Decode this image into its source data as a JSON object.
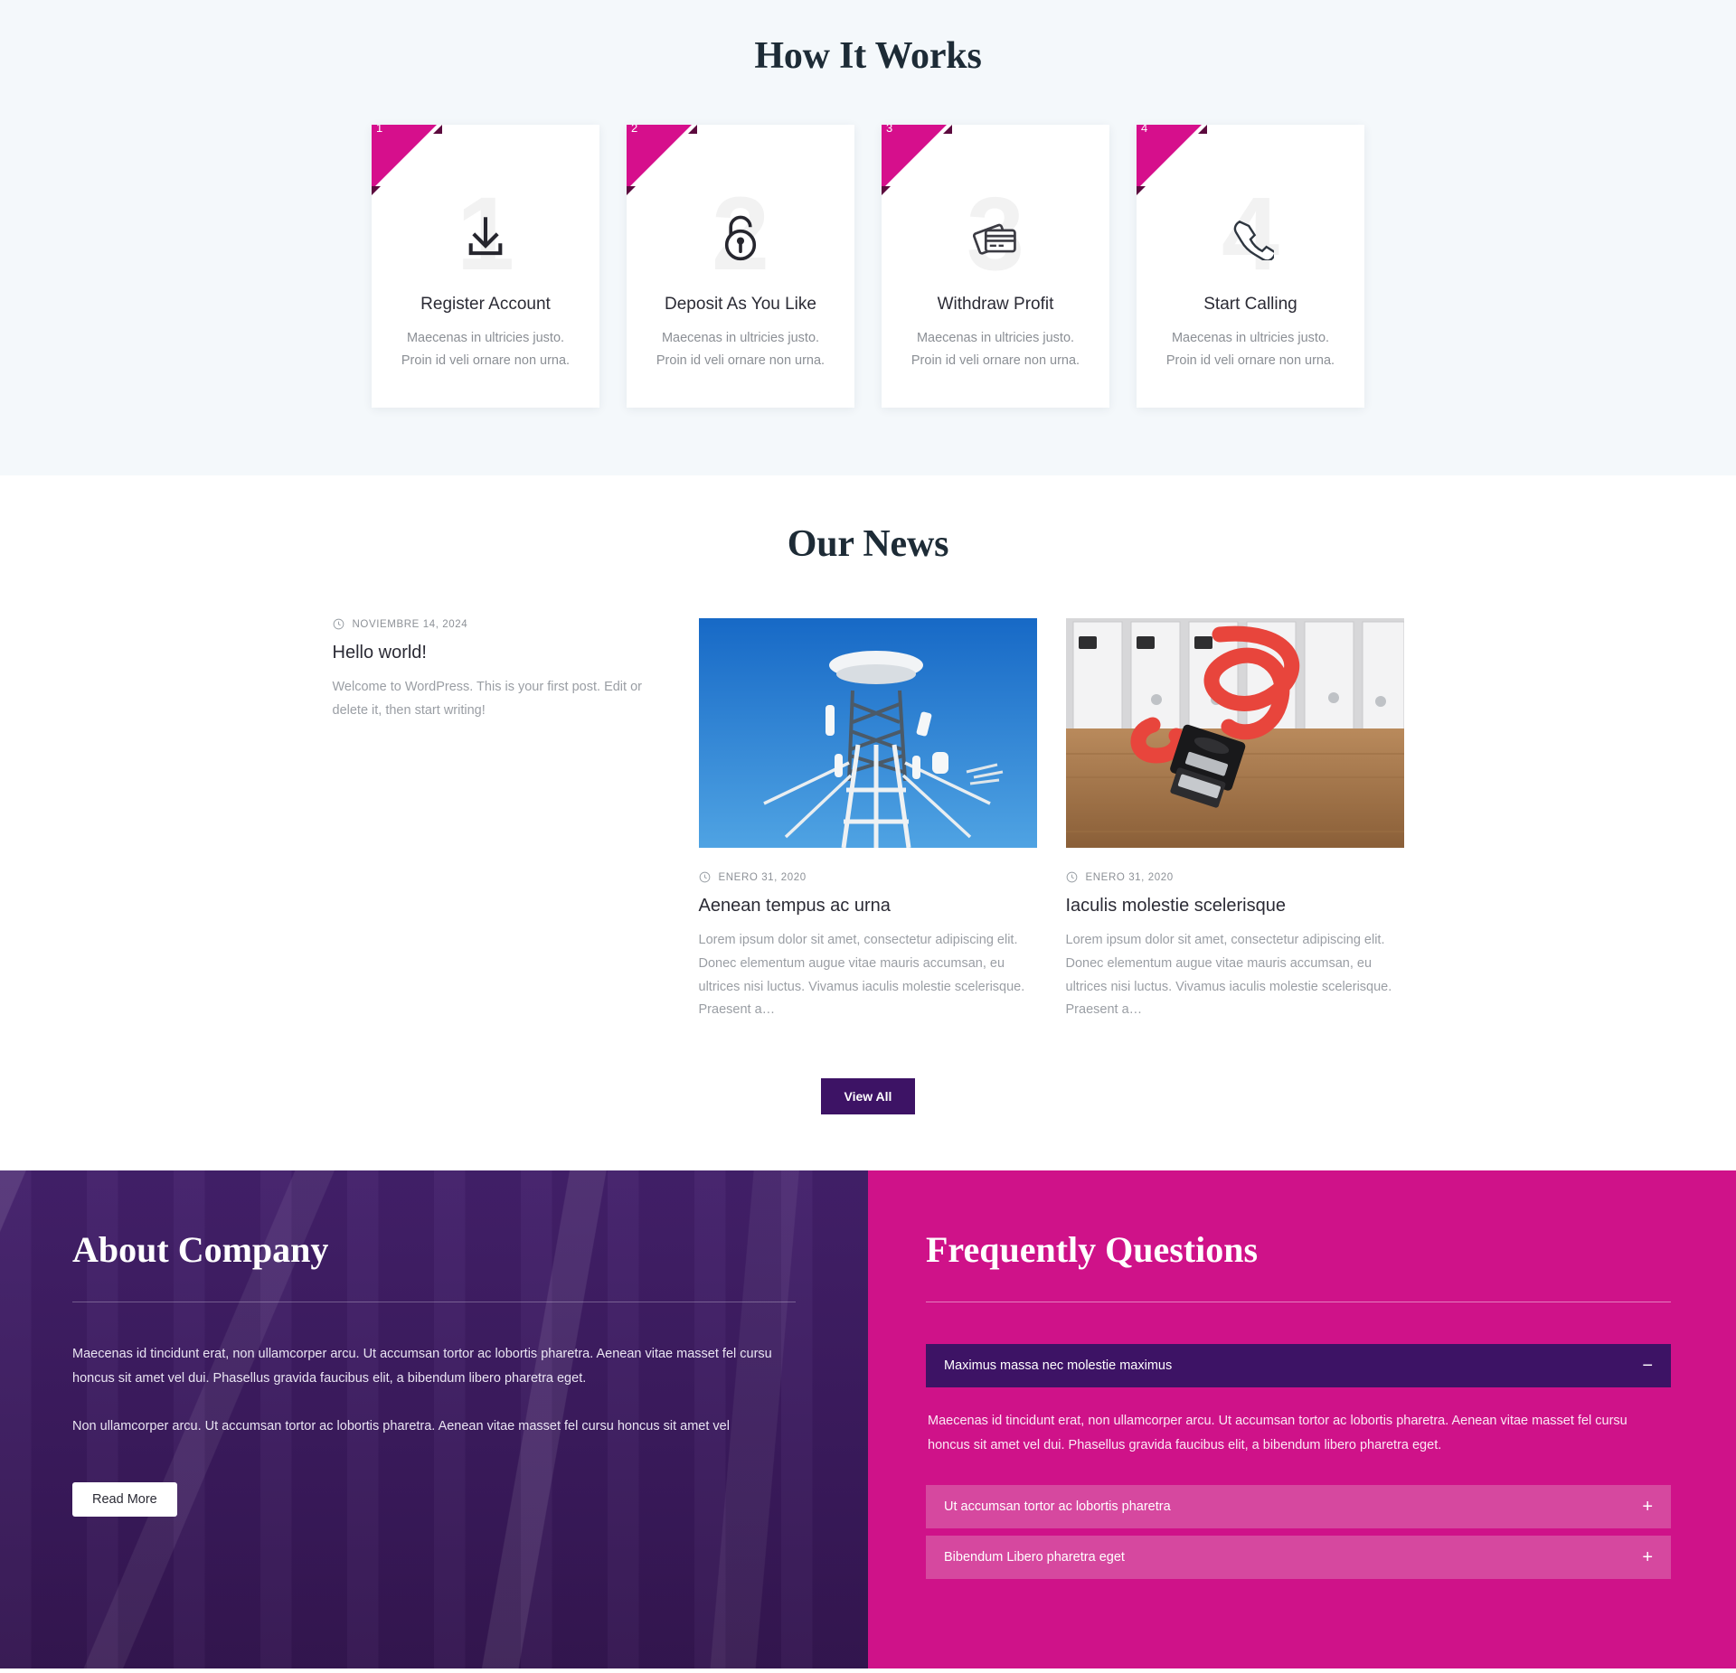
{
  "how_it_works": {
    "title": "How It Works",
    "cards": [
      {
        "number": "1",
        "watermark": "1",
        "icon": "download-icon",
        "title": "Register Account",
        "line1": "Maecenas in ultricies justo.",
        "line2": "Proin id veli ornare non urna."
      },
      {
        "number": "2",
        "watermark": "2",
        "icon": "padlock-icon",
        "title": "Deposit As You Like",
        "line1": "Maecenas in ultricies justo.",
        "line2": "Proin id veli ornare non urna."
      },
      {
        "number": "3",
        "watermark": "3",
        "icon": "credit-card-icon",
        "title": "Withdraw Profit",
        "line1": "Maecenas in ultricies justo.",
        "line2": "Proin id veli ornare non urna."
      },
      {
        "number": "4",
        "watermark": "4",
        "icon": "phone-handset-icon",
        "title": "Start Calling",
        "line1": "Maecenas in ultricies justo.",
        "line2": "Proin id veli ornare non urna."
      }
    ]
  },
  "news": {
    "title": "Our News",
    "posts": [
      {
        "date": "NOVIEMBRE 14, 2024",
        "title": "Hello world!",
        "excerpt": "Welcome to WordPress. This is your first post. Edit or delete it, then start writing!",
        "image": "none"
      },
      {
        "date": "ENERO 31, 2020",
        "title": "Aenean tempus ac urna",
        "excerpt": "Lorem ipsum dolor sit amet, consectetur adipiscing elit. Donec elementum augue vitae mauris accumsan, eu ultrices nisi luctus. Vivamus iaculis molestie scelerisque. Praesent a…",
        "image": "telecom-tower-photo"
      },
      {
        "date": "ENERO 31, 2020",
        "title": "Iaculis molestie scelerisque",
        "excerpt": "Lorem ipsum dolor sit amet, consectetur adipiscing elit. Donec elementum augue vitae mauris accumsan, eu ultrices nisi luctus. Vivamus iaculis molestie scelerisque. Praesent a…",
        "image": "red-sata-cable-photo"
      }
    ],
    "view_all_label": "View All"
  },
  "about": {
    "title": "About Company",
    "paragraph1": "Maecenas id tincidunt erat, non ullamcorper arcu. Ut accumsan tortor ac lobortis pharetra. Aenean vitae masset fel cursu honcus sit amet vel dui. Phasellus gravida faucibus elit, a bibendum libero pharetra eget.",
    "paragraph2": "Non ullamcorper arcu. Ut accumsan tortor ac lobortis pharetra. Aenean vitae masset fel cursu honcus sit amet vel",
    "read_more_label": "Read More"
  },
  "faq": {
    "title": "Frequently Questions",
    "items": [
      {
        "question": "Maximus massa nec molestie maximus",
        "answer": "Maecenas id tincidunt erat, non ullamcorper arcu. Ut accumsan tortor ac lobortis pharetra. Aenean vitae masset fel cursu honcus sit amet vel dui. Phasellus gravida faucibus elit, a bibendum libero pharetra eget.",
        "state": "open",
        "sign": "−"
      },
      {
        "question": "Ut accumsan tortor ac lobortis pharetra",
        "answer": "",
        "state": "closed",
        "sign": "+"
      },
      {
        "question": "Bibendum Libero pharetra eget",
        "answer": "",
        "state": "closed",
        "sign": "+"
      }
    ]
  },
  "colors": {
    "pink": "#cf1289",
    "ribbon_pink": "#d60f8c",
    "ribbon_shadow": "#5c0a3e",
    "purple": "#3d1365",
    "about_purple": "#3e1b63",
    "faq_closed_pink": "#d6489f",
    "light_bg": "#f4f8fb"
  }
}
